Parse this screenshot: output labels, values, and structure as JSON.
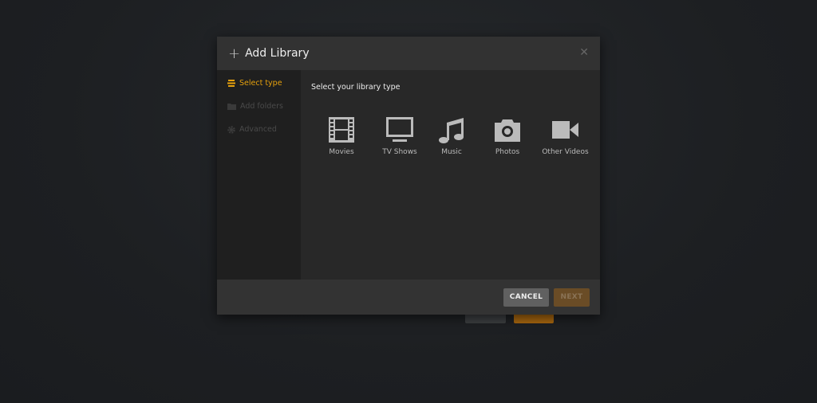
{
  "modal": {
    "title": "Add Library",
    "close_icon": "close-icon"
  },
  "sidebar": {
    "items": [
      {
        "label": "Select type",
        "icon": "stack-icon",
        "active": true
      },
      {
        "label": "Add folders",
        "icon": "folder-icon",
        "active": false
      },
      {
        "label": "Advanced",
        "icon": "gear-icon",
        "active": false
      }
    ]
  },
  "content": {
    "prompt": "Select your library type",
    "types": [
      {
        "label": "Movies",
        "icon": "film-icon"
      },
      {
        "label": "TV Shows",
        "icon": "tv-icon"
      },
      {
        "label": "Music",
        "icon": "music-note-icon"
      },
      {
        "label": "Photos",
        "icon": "camera-icon"
      },
      {
        "label": "Other Videos",
        "icon": "video-camera-icon"
      }
    ]
  },
  "footer": {
    "cancel_label": "CANCEL",
    "next_label": "NEXT"
  },
  "colors": {
    "accent": "#e5a00d"
  }
}
